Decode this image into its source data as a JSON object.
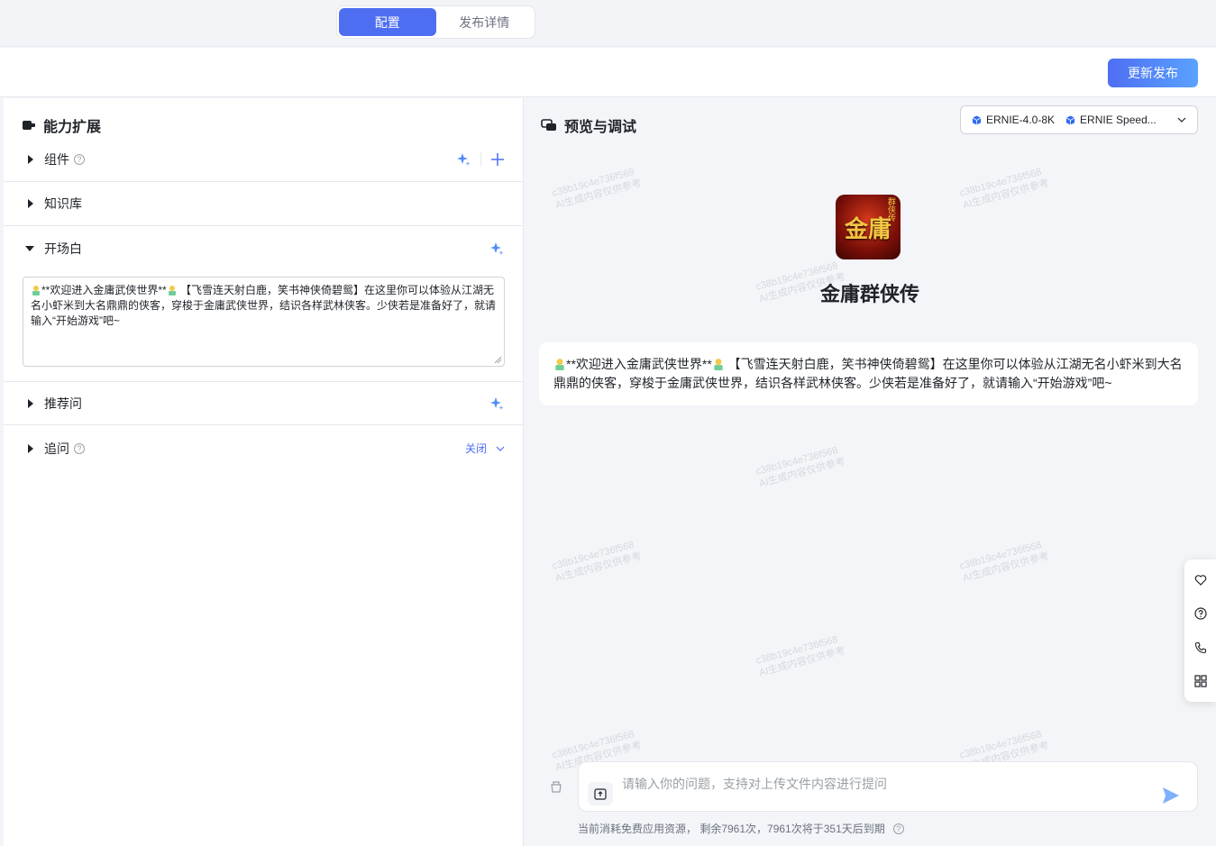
{
  "tabs": [
    {
      "label": "配置",
      "active": true
    },
    {
      "label": "发布详情",
      "active": false
    }
  ],
  "actions": {
    "publish_label": "更新发布"
  },
  "left": {
    "title": "能力扩展",
    "sections": {
      "components": {
        "label": "组件"
      },
      "knowledge": {
        "label": "知识库"
      },
      "opening": {
        "label": "开场白",
        "text_before": "**欢迎进入金庸武侠世界**",
        "text_after": " 【飞雪连天射白鹿，笑书神侠倚碧鸳】在这里你可以体验从江湖无名小虾米到大名鼎鼎的侠客，穿梭于金庸武侠世界，结识各样武林侠客。少侠若是准备好了，就请输入“开始游戏”吧~"
      },
      "suggested": {
        "label": "推荐问"
      },
      "followup": {
        "label": "追问",
        "state": "关闭"
      }
    }
  },
  "right": {
    "title": "预览与调试",
    "models": [
      "ERNIE-4.0-8K",
      "ERNIE Speed..."
    ],
    "app": {
      "name": "金庸群侠传",
      "logo_glyph": "金庸",
      "logo_badge": "群侠传"
    },
    "message": {
      "text_before": "**欢迎进入金庸武侠世界**",
      "text_after": " 【飞雪连天射白鹿，笑书神侠倚碧鸳】在这里你可以体验从江湖无名小虾米到大名鼎鼎的侠客，穿梭于金庸武侠世界，结识各样武林侠客。少侠若是准备好了，就请输入“开始游戏”吧~"
    },
    "input": {
      "placeholder": "请输入你的问题，支持对上传文件内容进行提问"
    },
    "footer": "当前消耗免费应用资源， 剩余7961次，7961次将于351天后到期",
    "watermark": [
      "c38b19c4e736f568",
      "AI生成内容仅供参考"
    ]
  },
  "colors": {
    "accent": "#4e6ef2",
    "sparkle": "#4e8ef7"
  }
}
